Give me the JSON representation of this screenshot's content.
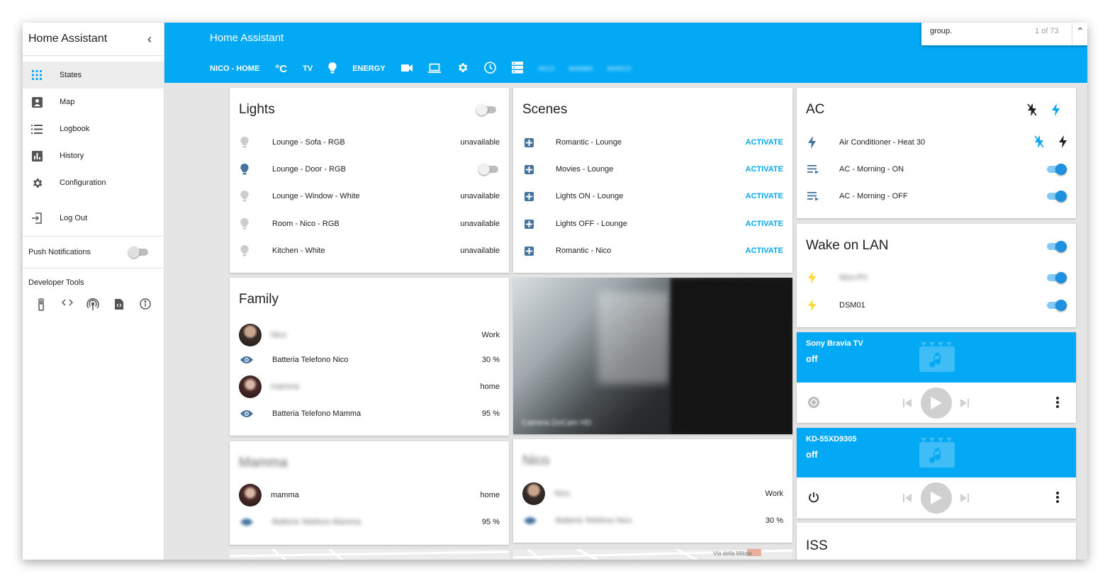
{
  "sidebar": {
    "title": "Home Assistant",
    "items": [
      {
        "label": "States",
        "icon": "grid-icon"
      },
      {
        "label": "Map",
        "icon": "account-box-icon"
      },
      {
        "label": "Logbook",
        "icon": "list-icon"
      },
      {
        "label": "History",
        "icon": "chart-icon"
      },
      {
        "label": "Configuration",
        "icon": "gear-icon"
      },
      {
        "label": "Log Out",
        "icon": "logout-icon"
      }
    ],
    "push_label": "Push Notifications",
    "dev_tools_label": "Developer Tools"
  },
  "header": {
    "title": "Home Assistant",
    "tabs": {
      "home": "NICO - HOME",
      "celsius": "°C",
      "tv": "TV",
      "energy": "ENERGY"
    },
    "blurred_tabs": [
      "NICO",
      "MAMMA",
      "MARCO"
    ]
  },
  "search": {
    "query": "group.",
    "count": "1 of 73"
  },
  "lights": {
    "title": "Lights",
    "rows": [
      {
        "name": "Lounge - Sofa - RGB",
        "state": "unavailable"
      },
      {
        "name": "Lounge - Door - RGB",
        "state": ""
      },
      {
        "name": "Lounge - Window - White",
        "state": "unavailable"
      },
      {
        "name": "Room - Nico - RGB",
        "state": "unavailable"
      },
      {
        "name": "Kitchen - White",
        "state": "unavailable"
      }
    ]
  },
  "scenes": {
    "title": "Scenes",
    "action": "ACTIVATE",
    "rows": [
      {
        "name": "Romantic - Lounge"
      },
      {
        "name": "Movies - Lounge"
      },
      {
        "name": "Lights ON - Lounge"
      },
      {
        "name": "Lights OFF - Lounge"
      },
      {
        "name": "Romantic - Nico"
      }
    ]
  },
  "ac": {
    "title": "AC",
    "rows": [
      {
        "name": "Air Conditioner - Heat 30"
      },
      {
        "name": "AC - Morning - ON"
      },
      {
        "name": "AC - Morning - OFF"
      }
    ]
  },
  "wol": {
    "title": "Wake on LAN",
    "rows": [
      {
        "name": "Nico-PC"
      },
      {
        "name": "DSM01"
      }
    ]
  },
  "family": {
    "title": "Family",
    "rows": [
      {
        "name": "Nico",
        "state": "Work"
      },
      {
        "name": "Batteria Telefono Nico",
        "state": "30 %"
      },
      {
        "name": "mamma",
        "state": "home"
      },
      {
        "name": "Batteria Telefono Mamma",
        "state": "95 %"
      }
    ]
  },
  "camera": {
    "caption": "Camera DoCam HD"
  },
  "mamma": {
    "title": "Mamma",
    "rows": [
      {
        "name": "mamma",
        "state": "home"
      },
      {
        "name": "Batteria Telefono Mamma",
        "state": "95 %"
      }
    ]
  },
  "nico": {
    "title": "Nico",
    "rows": [
      {
        "name": "Nico",
        "state": "Work"
      },
      {
        "name": "Batteria Telefono Nico",
        "state": "30 %"
      }
    ]
  },
  "media1": {
    "name": "Sony Bravia TV",
    "state": "off"
  },
  "media2": {
    "name": "KD-55XD9305",
    "state": "off"
  },
  "iss": {
    "title": "ISS"
  },
  "map_label": "Via della Milizie",
  "colors": {
    "accent": "#03a9f4",
    "toggle_on": "#1e90e0",
    "bulb_on": "#44739e",
    "bolt_yellow": "#fdd835"
  }
}
